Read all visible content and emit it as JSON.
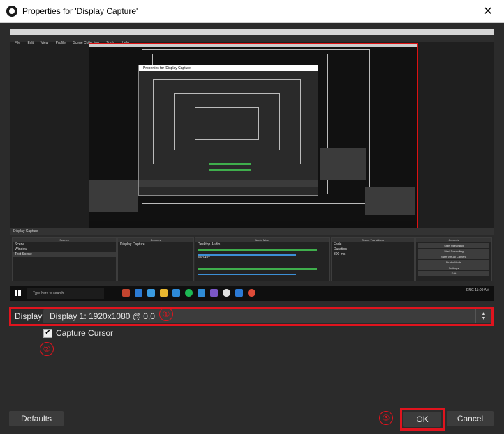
{
  "window": {
    "title": "Properties for 'Display Capture'",
    "close_label": "✕"
  },
  "preview": {
    "menu": [
      "File",
      "Edit",
      "View",
      "Profile",
      "Scene Collection",
      "Tools",
      "Help"
    ],
    "nested_dialog_title": "Properties for 'Display Capture'",
    "dock_bar_text": "Display Capture",
    "docks": {
      "scenes_header": "Scenes",
      "scenes": [
        "Scene",
        "Window",
        "Test Scene"
      ],
      "sources_header": "Sources",
      "sources": [
        "Display Capture"
      ],
      "mixer_header": "Audio Mixer",
      "mixer_tracks": [
        "Desktop Audio",
        "Mic/Aux"
      ],
      "transitions_header": "Scene Transitions",
      "transition_value": "Fade",
      "duration_label": "Duration",
      "duration_value": "300 ms",
      "controls_header": "Controls",
      "controls": [
        "Start Streaming",
        "Start Recording",
        "Start Virtual Camera",
        "Studio Mode",
        "Settings",
        "Exit"
      ]
    },
    "taskbar": {
      "search_placeholder": "Type here to search",
      "tray_text": "ENG 11:09 AM"
    }
  },
  "display": {
    "label": "Display",
    "value": "Display 1: 1920x1080 @ 0,0",
    "arrow_up": "▲",
    "arrow_down": "▼"
  },
  "capture_cursor": {
    "label": "Capture Cursor",
    "checked": true,
    "check_glyph": "✔"
  },
  "markers": [
    "①",
    "②",
    "③"
  ],
  "buttons": {
    "defaults": "Defaults",
    "ok": "OK",
    "cancel": "Cancel"
  },
  "colors": {
    "background": "#2b2b2b",
    "control": "#3c3c3c",
    "highlight": "#e0141e",
    "meter_green": "#3fae4c"
  }
}
